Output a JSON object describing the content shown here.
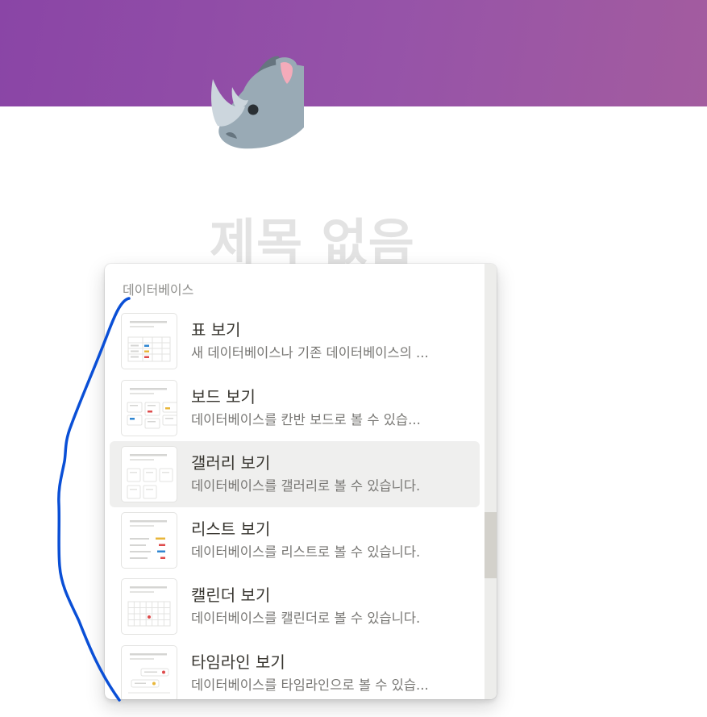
{
  "page": {
    "title": "제목 없음",
    "icon": "rhino-emoji-icon"
  },
  "colors": {
    "cover_gradient_start": "#8a45a6",
    "cover_gradient_end": "#a35c9f",
    "annotation_stroke": "#0a4fd6",
    "selected_row": "#efefee"
  },
  "menu": {
    "section_label": "데이터베이스",
    "items": [
      {
        "title": "표 보기",
        "description": "새 데이터베이스나 기존 데이터베이스의 ...",
        "icon": "table-view-icon"
      },
      {
        "title": "보드 보기",
        "description": "데이터베이스를 칸반 보드로 볼 수 있습...",
        "icon": "board-view-icon"
      },
      {
        "title": "갤러리 보기",
        "description": "데이터베이스를 갤러리로 볼 수 있습니다.",
        "icon": "gallery-view-icon",
        "selected": true
      },
      {
        "title": "리스트 보기",
        "description": "데이터베이스를 리스트로 볼 수 있습니다.",
        "icon": "list-view-icon"
      },
      {
        "title": "캘린더 보기",
        "description": "데이터베이스를 캘린더로 볼 수 있습니다.",
        "icon": "calendar-view-icon"
      },
      {
        "title": "타임라인 보기",
        "description": "데이터베이스를 타임라인으로 볼 수 있습...",
        "icon": "timeline-view-icon"
      }
    ]
  }
}
